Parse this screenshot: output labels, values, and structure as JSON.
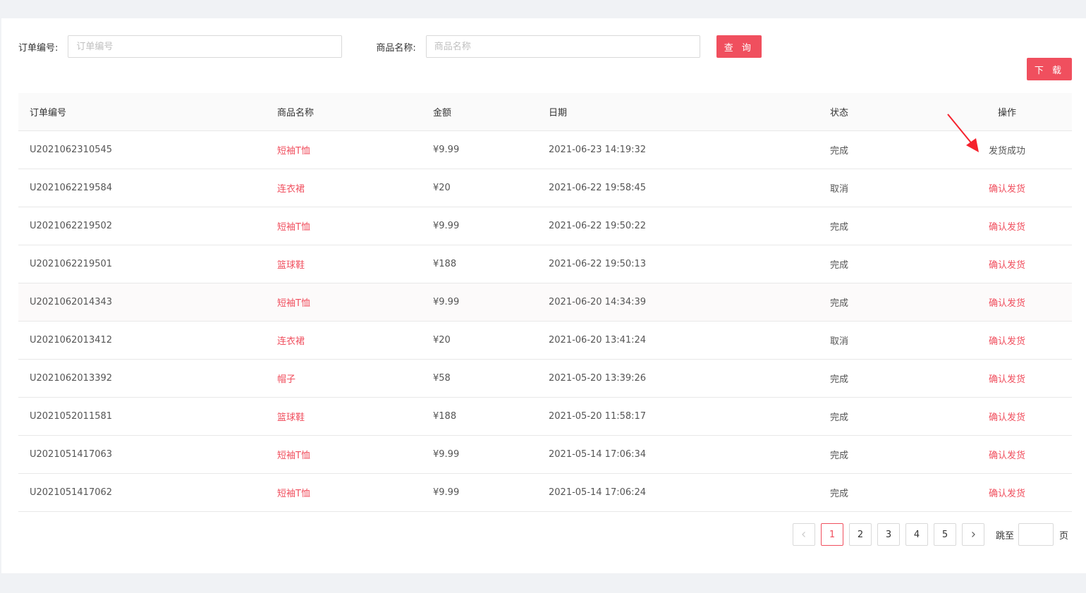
{
  "search": {
    "order_label": "订单编号:",
    "order_placeholder": "订单编号",
    "order_value": "",
    "product_label": "商品名称:",
    "product_placeholder": "商品名称",
    "product_value": "",
    "query_button": "查 询"
  },
  "download_button": "下 载",
  "table": {
    "headers": {
      "order_id": "订单编号",
      "product": "商品名称",
      "amount": "金额",
      "date": "日期",
      "status": "状态",
      "action": "操作"
    },
    "rows": [
      {
        "order_id": "U2021062310545",
        "product": "短袖T恤",
        "amount": "¥9.99",
        "date": "2021-06-23 14:19:32",
        "status": "完成",
        "action": "发货成功"
      },
      {
        "order_id": "U2021062219584",
        "product": "连衣裙",
        "amount": "¥20",
        "date": "2021-06-22 19:58:45",
        "status": "取消",
        "action": "确认发货"
      },
      {
        "order_id": "U2021062219502",
        "product": "短袖T恤",
        "amount": "¥9.99",
        "date": "2021-06-22 19:50:22",
        "status": "完成",
        "action": "确认发货"
      },
      {
        "order_id": "U2021062219501",
        "product": "篮球鞋",
        "amount": "¥188",
        "date": "2021-06-22 19:50:13",
        "status": "完成",
        "action": "确认发货"
      },
      {
        "order_id": "U2021062014343",
        "product": "短袖T恤",
        "amount": "¥9.99",
        "date": "2021-06-20 14:34:39",
        "status": "完成",
        "action": "确认发货"
      },
      {
        "order_id": "U2021062013412",
        "product": "连衣裙",
        "amount": "¥20",
        "date": "2021-06-20 13:41:24",
        "status": "取消",
        "action": "确认发货"
      },
      {
        "order_id": "U2021062013392",
        "product": "帽子",
        "amount": "¥58",
        "date": "2021-05-20 13:39:26",
        "status": "完成",
        "action": "确认发货"
      },
      {
        "order_id": "U2021052011581",
        "product": "篮球鞋",
        "amount": "¥188",
        "date": "2021-05-20 11:58:17",
        "status": "完成",
        "action": "确认发货"
      },
      {
        "order_id": "U2021051417063",
        "product": "短袖T恤",
        "amount": "¥9.99",
        "date": "2021-05-14 17:06:34",
        "status": "完成",
        "action": "确认发货"
      },
      {
        "order_id": "U2021051417062",
        "product": "短袖T恤",
        "amount": "¥9.99",
        "date": "2021-05-14 17:06:24",
        "status": "完成",
        "action": "确认发货"
      }
    ]
  },
  "pagination": {
    "pages": [
      "1",
      "2",
      "3",
      "4",
      "5"
    ],
    "current": "1",
    "prev_icon": "chevron-left-icon",
    "next_icon": "chevron-right-icon",
    "jump_label": "跳至",
    "jump_value": "",
    "page_suffix": "页"
  },
  "colors": {
    "accent": "#f04f5e",
    "annotation_arrow": "#f5222d"
  }
}
